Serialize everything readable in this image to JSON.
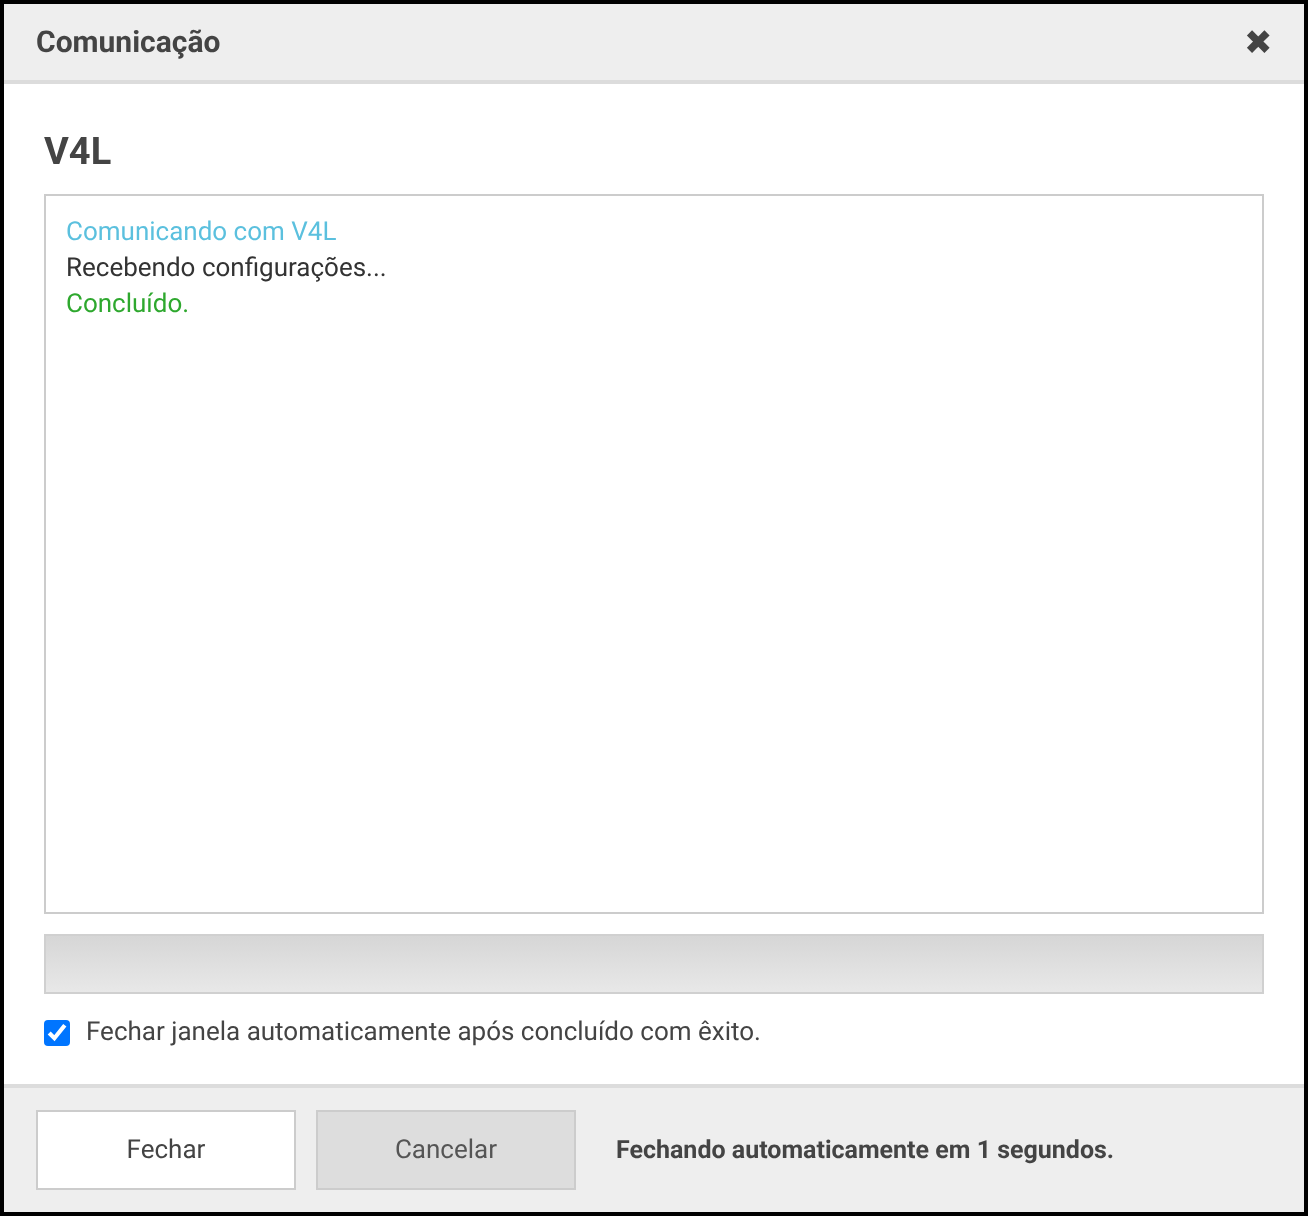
{
  "window": {
    "title": "Comunicação",
    "close": "✖"
  },
  "device": "V4L",
  "log": [
    {
      "kind": "info",
      "text": "Comunicando com V4L"
    },
    {
      "kind": "normal",
      "text": "Recebendo configurações..."
    },
    {
      "kind": "success",
      "text": "Concluído."
    }
  ],
  "progress": {
    "level": 0
  },
  "auto_close": {
    "label": "Fechar janela automaticamente após concluído com êxito.",
    "checked": true
  },
  "buttons": [
    {
      "label": "Fechar",
      "disabled": false
    },
    {
      "label": "Cancelar",
      "disabled": true
    }
  ],
  "status": "Fechando automaticamente em 1 segundos."
}
